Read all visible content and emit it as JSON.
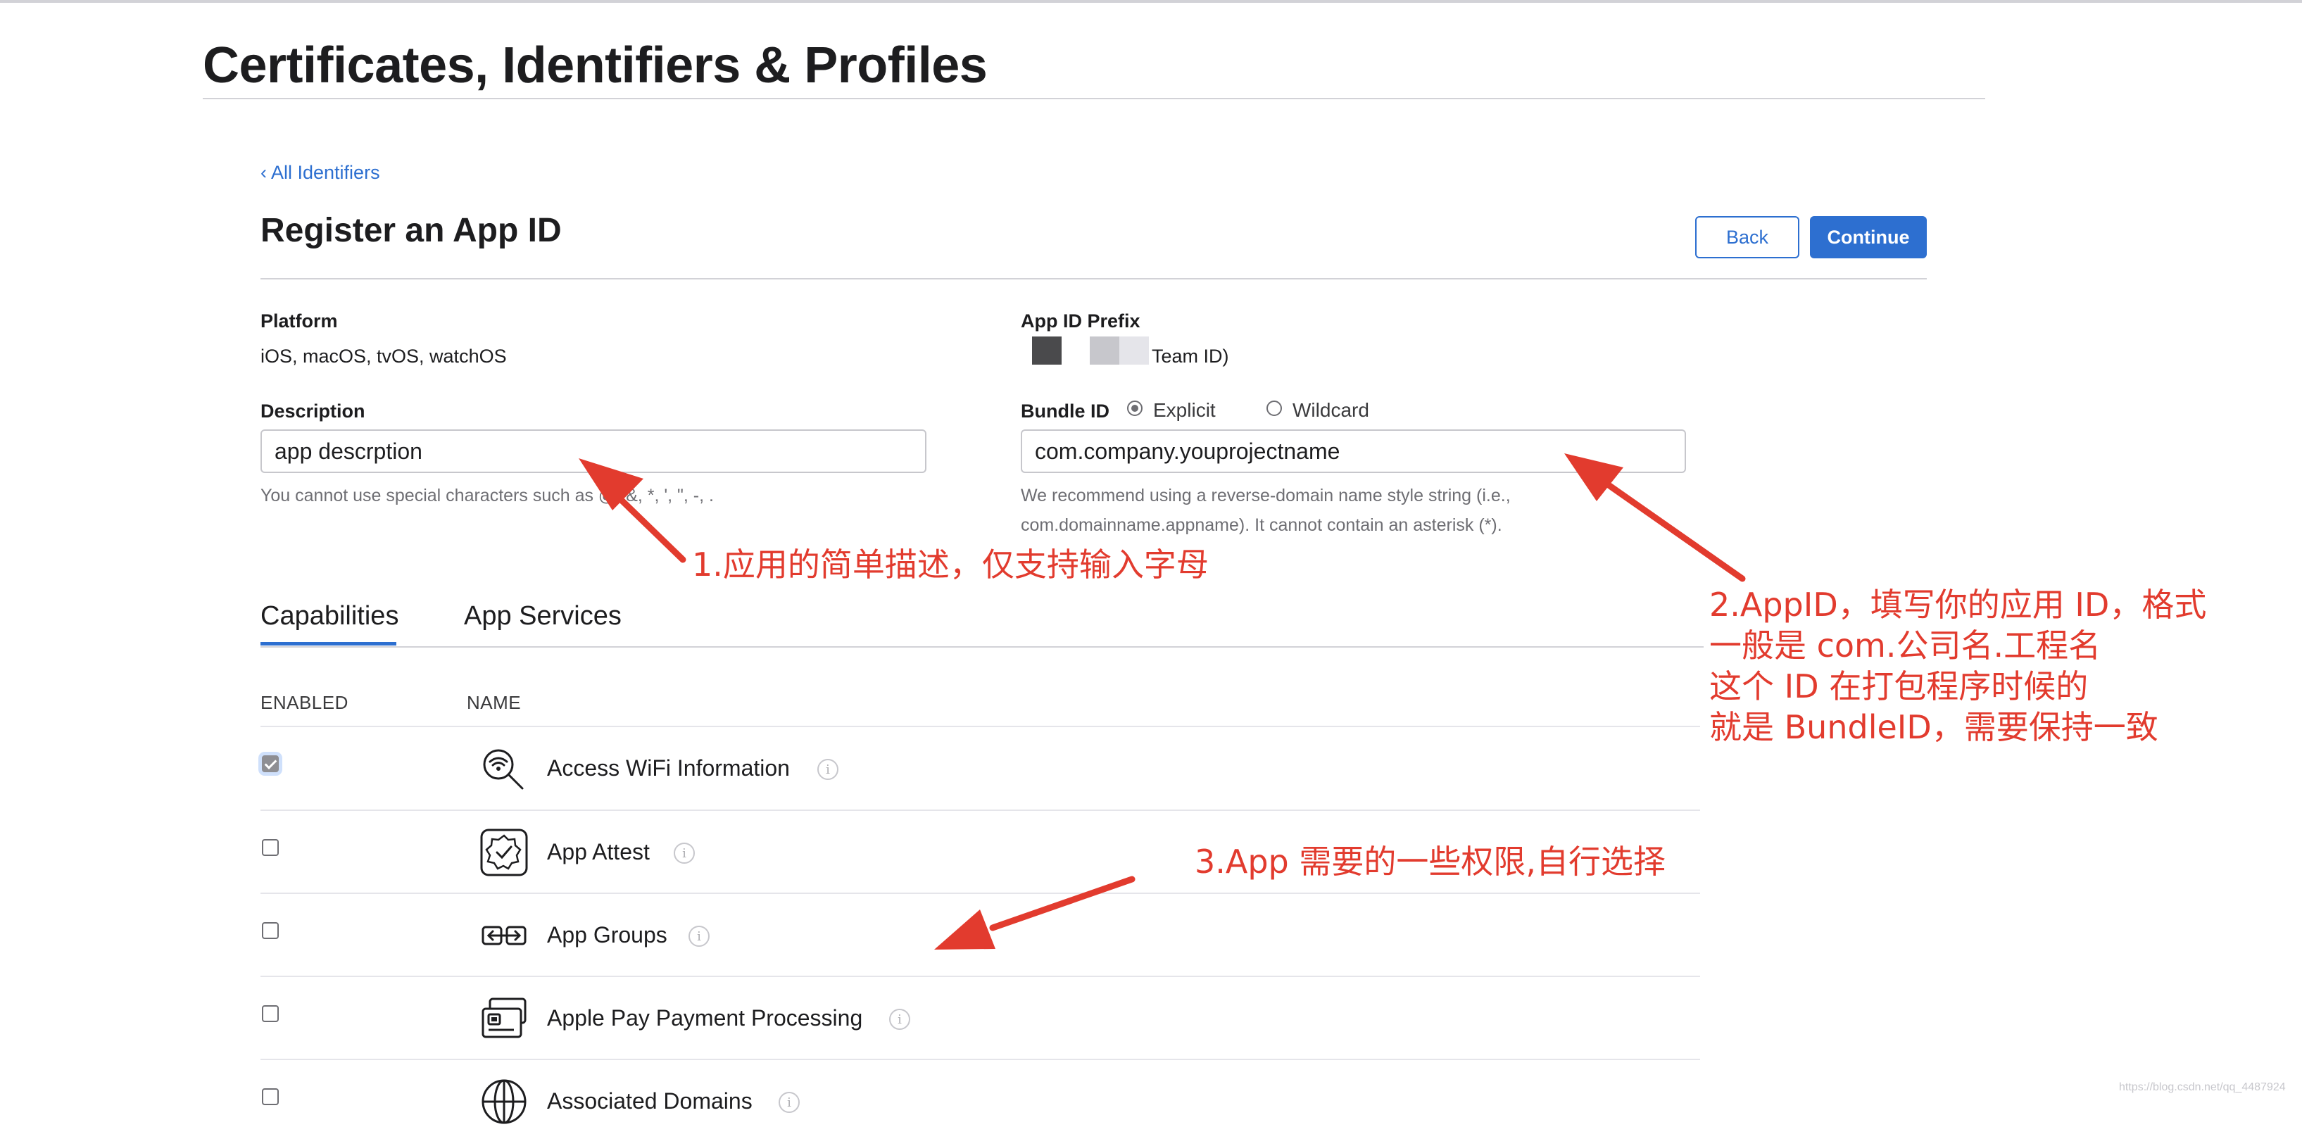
{
  "header": {
    "title": "Certificates, Identifiers & Profiles"
  },
  "nav": {
    "back_link": "‹ All Identifiers"
  },
  "section": {
    "title": "Register an App ID"
  },
  "buttons": {
    "back": "Back",
    "continue": "Continue"
  },
  "platform": {
    "label": "Platform",
    "value": "iOS, macOS, tvOS, watchOS"
  },
  "app_id_prefix": {
    "label": "App ID Prefix",
    "value_suffix": "Team ID)"
  },
  "description": {
    "label": "Description",
    "value": "app descrption",
    "hint": "You cannot use special characters such as @, &, *, ', \", -, ."
  },
  "bundle_id": {
    "label": "Bundle ID",
    "options": [
      {
        "label": "Explicit",
        "selected": true
      },
      {
        "label": "Wildcard",
        "selected": false
      }
    ],
    "value": "com.company.youprojectname",
    "hint_line1": "We recommend using a reverse-domain name style string (i.e.,",
    "hint_line2": "com.domainname.appname). It cannot contain an asterisk (*)."
  },
  "tabs": [
    {
      "label": "Capabilities",
      "active": true
    },
    {
      "label": "App Services",
      "active": false
    }
  ],
  "table": {
    "columns": [
      "ENABLED",
      "NAME"
    ],
    "rows": [
      {
        "name": "Access WiFi Information",
        "enabled": true,
        "icon": "wifi-search-icon"
      },
      {
        "name": "App Attest",
        "enabled": false,
        "icon": "attest-badge-icon"
      },
      {
        "name": "App Groups",
        "enabled": false,
        "icon": "app-groups-icon"
      },
      {
        "name": "Apple Pay Payment Processing",
        "enabled": false,
        "icon": "apple-pay-card-icon"
      },
      {
        "name": "Associated Domains",
        "enabled": false,
        "icon": "globe-icon"
      }
    ]
  },
  "annotations": {
    "note1": "1.应用的简单描述，仅支持输入字母",
    "note2": [
      "2.AppID，填写你的应用 ID，格式",
      "一般是 com.公司名.工程名",
      "这个 ID 在打包程序时候的",
      "就是 BundleID，需要保持一致"
    ],
    "note3": "3.App 需要的一些权限,自行选择",
    "color": "#e23b2e"
  },
  "watermark": "https://blog.csdn.net/qq_4487924",
  "colors": {
    "accent": "#2d6fd0",
    "annotation": "#e23b2e"
  }
}
